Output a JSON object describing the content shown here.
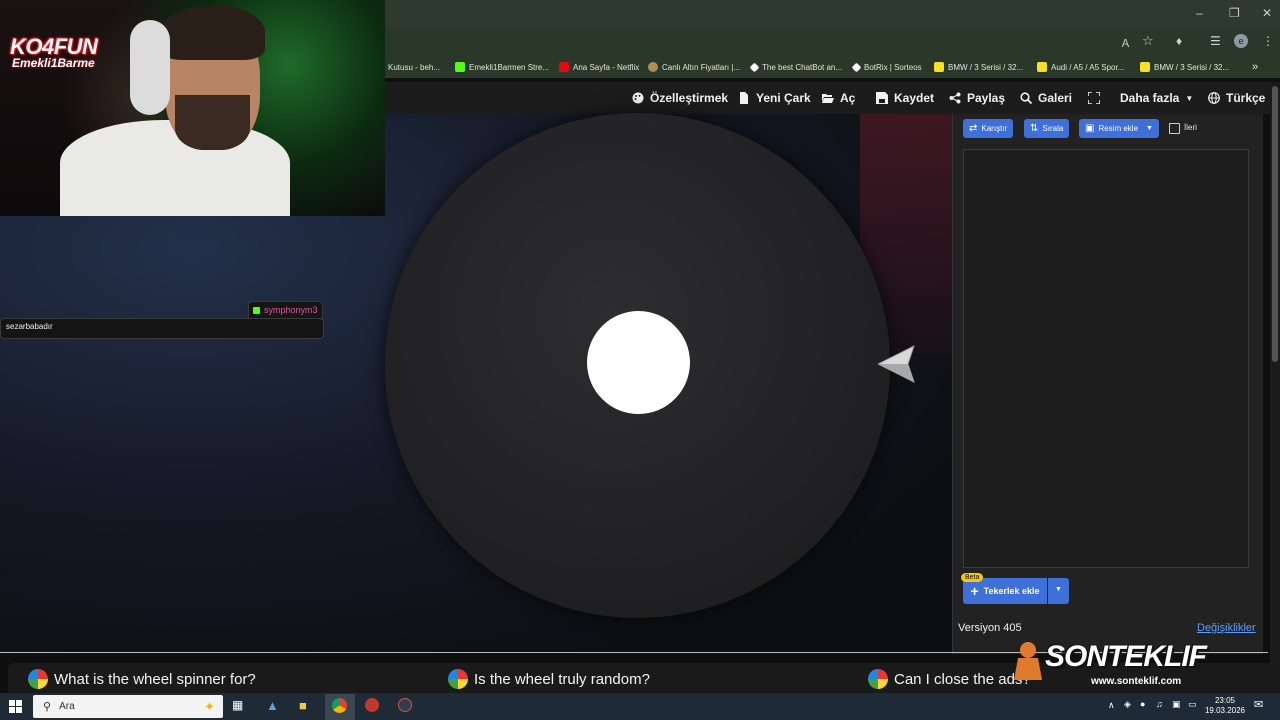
{
  "browser": {
    "bookmarks": [
      {
        "label": "Kutusu - beh...",
        "color": "#2a3829"
      },
      {
        "label": "Emekli1Barmen Stre...",
        "color": "#53fc18"
      },
      {
        "label": "Ana Sayfa - Netflix",
        "color": "#e50914"
      },
      {
        "label": "Canlı Altın Fiyatları |...",
        "color": "#b08d57"
      },
      {
        "label": "The best ChatBot an...",
        "color": "#ffffff"
      },
      {
        "label": "BotRix | Sorteos",
        "color": "#ffffff"
      },
      {
        "label": "BMW / 3 Serisi / 32...",
        "color": "#f5e12b"
      },
      {
        "label": "Audi / A5 / A5 Spor...",
        "color": "#f5e12b"
      },
      {
        "label": "BMW / 3 Serisi / 32...",
        "color": "#f5e12b"
      }
    ],
    "avatar_letter": "e",
    "more": "»"
  },
  "nav": {
    "customize": "Özelleştirmek",
    "new_wheel": "Yeni Çark",
    "open": "Aç",
    "save": "Kaydet",
    "share": "Paylaş",
    "gallery": "Galeri",
    "more": "Daha fazla",
    "language": "Türkçe"
  },
  "webcam": {
    "brand_top": "KO4FUN",
    "brand_bottom": "Emekli1Barme"
  },
  "chat": {
    "username": "symphonym3",
    "message": "sezarbabadır"
  },
  "panel": {
    "shuffle": "Karıştır",
    "sort": "Sırala",
    "add_image": "Resim ekle",
    "advanced": "İleri",
    "beta": "Beta",
    "add_wheel": "Tekerlek ekle",
    "version": "Versiyon 405",
    "changes": "Değişiklikler"
  },
  "faq": [
    "What is the wheel spinner for?",
    "Is the wheel truly random?",
    "Can I close the ads?"
  ],
  "watermark": {
    "title": "SONTEKLIF",
    "url": "www.sonteklif.com"
  },
  "taskbar": {
    "search_placeholder": "Ara",
    "time": "23:05",
    "date": "19.03.2026"
  }
}
